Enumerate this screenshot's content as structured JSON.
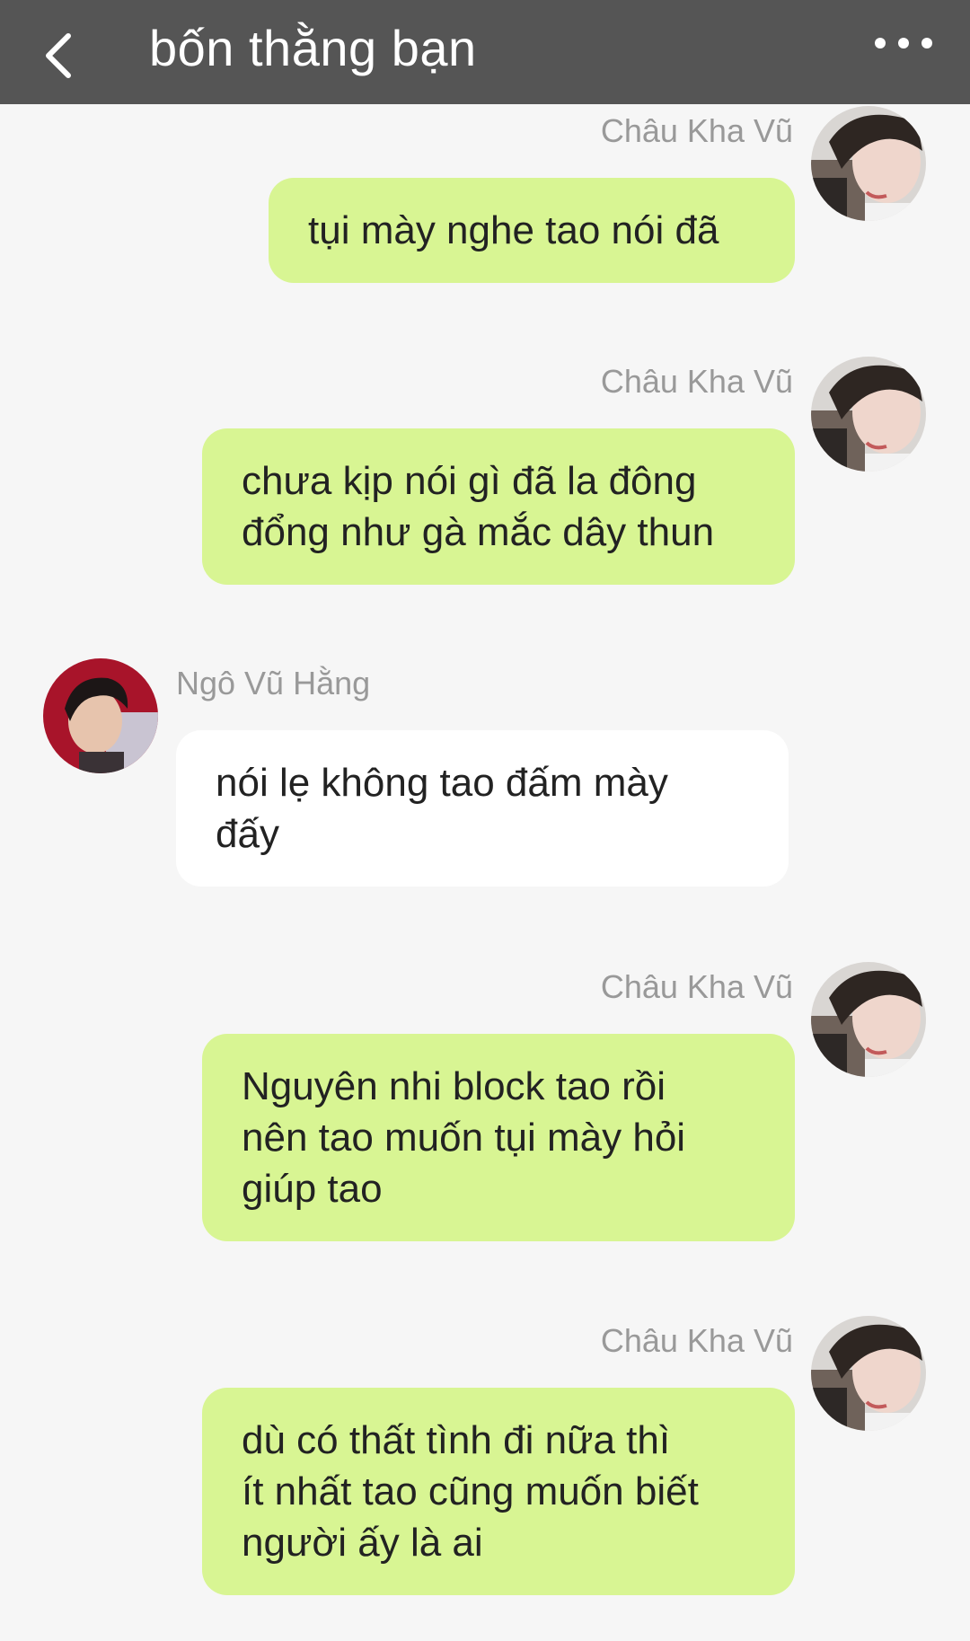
{
  "header": {
    "title": "bốn thằng bạn",
    "back_icon": "chevron-left-icon",
    "more_icon": "more-dots-icon"
  },
  "colors": {
    "header_bg": "#555555",
    "chat_bg": "#f6f6f6",
    "outgoing_bubble": "#d8f593",
    "incoming_bubble": "#ffffff",
    "sender_text": "#999999"
  },
  "messages": [
    {
      "side": "right",
      "sender": "Châu Kha Vũ",
      "lines": [
        "tụi mày nghe tao nói đã"
      ]
    },
    {
      "side": "right",
      "sender": "Châu Kha Vũ",
      "lines": [
        "chưa kịp nói gì đã la đông",
        "đổng như gà mắc dây thun"
      ]
    },
    {
      "side": "left",
      "sender": "Ngô Vũ Hằng",
      "lines": [
        "nói lẹ không tao đấm mày",
        "đấy"
      ]
    },
    {
      "side": "right",
      "sender": "Châu Kha Vũ",
      "lines": [
        "Nguyên nhi block tao rồi",
        "nên tao muốn tụi mày hỏi",
        "giúp tao"
      ]
    },
    {
      "side": "right",
      "sender": "Châu Kha Vũ",
      "lines": [
        "dù có thất tình đi nữa thì",
        "ít nhất tao cũng muốn biết",
        "người ấy là ai"
      ]
    }
  ]
}
